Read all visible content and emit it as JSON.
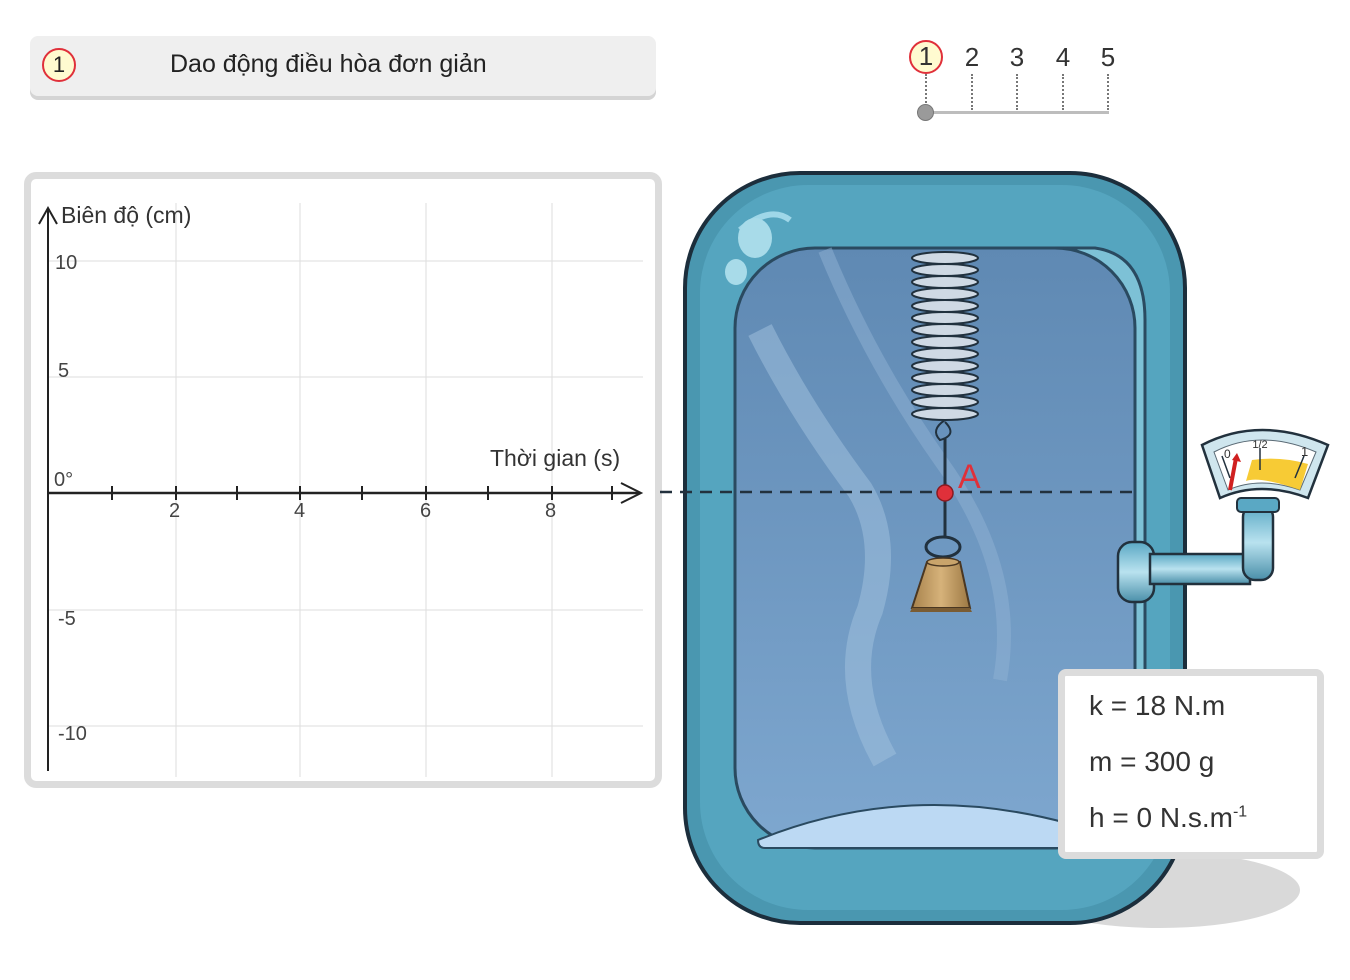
{
  "header": {
    "step_badge": "1",
    "title": "Dao động điều hòa đơn giản"
  },
  "step_nav": {
    "steps": [
      "1",
      "2",
      "3",
      "4",
      "5"
    ],
    "active": "1"
  },
  "graph": {
    "y_axis_label": "Biên độ (cm)",
    "x_axis_label": "Thời gian (s)",
    "y_ticks": [
      "10",
      "5",
      "0°",
      "-5",
      "-10"
    ],
    "x_ticks": [
      "2",
      "4",
      "6",
      "8"
    ]
  },
  "simulation": {
    "point_label": "A",
    "gauge_labels": [
      "0",
      "1/2",
      "1"
    ],
    "gauge_level": 0.05
  },
  "parameters": {
    "k_text": "k = 18 N.m",
    "m_text": "m = 300 g",
    "h_text": "h = 0 N.s.m",
    "h_superscript": "-1"
  },
  "colors": {
    "accent_red": "#e0303a",
    "badge_fill": "#fffbd0",
    "tank_frame": "#4f97b3",
    "tank_water": "#6f9bc4"
  }
}
